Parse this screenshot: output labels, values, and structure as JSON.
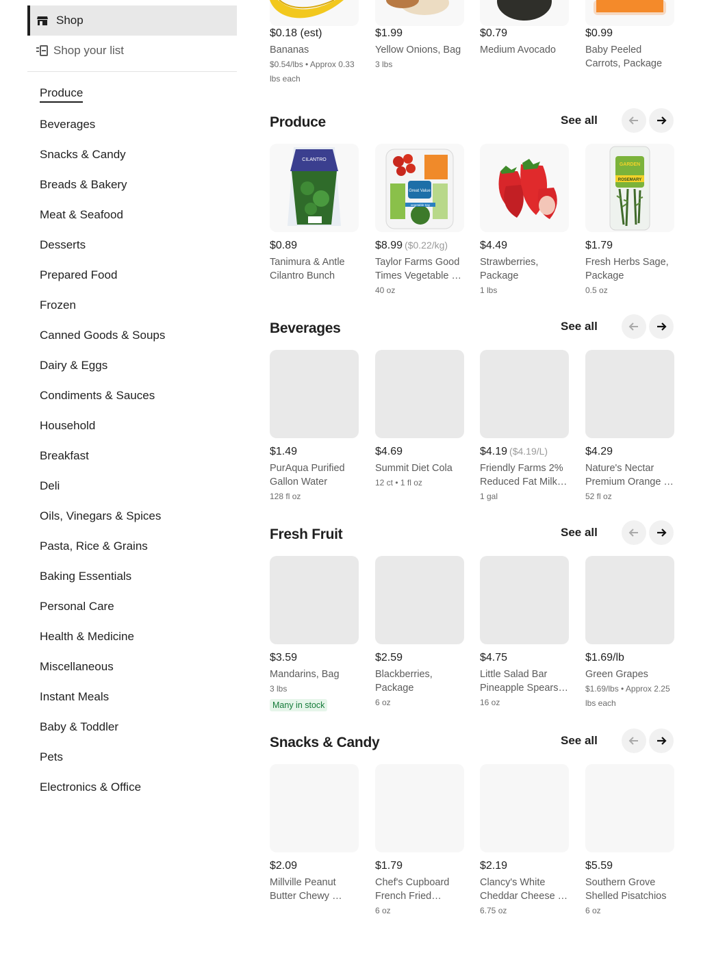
{
  "sidebar": {
    "shop_label": "Shop",
    "shop_icon": "store-icon",
    "list_label": "Shop your list",
    "list_icon": "list-icon",
    "categories": [
      "Produce",
      "Beverages",
      "Snacks & Candy",
      "Breads & Bakery",
      "Meat & Seafood",
      "Desserts",
      "Prepared Food",
      "Frozen",
      "Canned Goods & Soups",
      "Dairy & Eggs",
      "Condiments & Sauces",
      "Household",
      "Breakfast",
      "Deli",
      "Oils, Vinegars & Spices",
      "Pasta, Rice & Grains",
      "Baking Essentials",
      "Personal Care",
      "Health & Medicine",
      "Miscellaneous",
      "Instant Meals",
      "Baby & Toddler",
      "Pets",
      "Electronics & Office"
    ],
    "active_category": "Produce"
  },
  "top_row": {
    "items": [
      {
        "price": "$0.18 (est)",
        "name": "Bananas",
        "size": "$0.54/lbs • Approx 0.33 lbs each"
      },
      {
        "price": "$1.99",
        "name": "Yellow Onions, Bag",
        "size": "3 lbs"
      },
      {
        "price": "$0.79",
        "name": "Medium Avocado",
        "size": ""
      },
      {
        "price": "$0.99",
        "name": "Baby Peeled Carrots, Package",
        "size": ""
      }
    ]
  },
  "sections": [
    {
      "title": "Produce",
      "see_all": "See all",
      "items": [
        {
          "price": "$0.89",
          "unit": "",
          "name": "Tanimura & Antle Cilantro Bunch",
          "size": ""
        },
        {
          "price": "$8.99",
          "unit": "($0.22/kg)",
          "name": "Taylor Farms Good Times Vegetable …",
          "size": "40 oz"
        },
        {
          "price": "$4.49",
          "unit": "",
          "name": "Strawberries, Package",
          "size": "1 lbs"
        },
        {
          "price": "$1.79",
          "unit": "",
          "name": "Fresh Herbs Sage, Package",
          "size": "0.5 oz"
        }
      ],
      "image_labels": {
        "cilantro_tag": "CILANTRO",
        "herb_brand": "GARDEN",
        "herb_name": "ROSEMARY",
        "veg_brand": "Great Value",
        "veg_tray": "vegetable tray"
      }
    },
    {
      "title": "Beverages",
      "see_all": "See all",
      "items": [
        {
          "price": "$1.49",
          "unit": "",
          "name": "PurAqua Purified Gallon Water",
          "size": "128 fl oz"
        },
        {
          "price": "$4.69",
          "unit": "",
          "name": "Summit Diet Cola",
          "size": "12 ct • 1 fl oz"
        },
        {
          "price": "$4.19",
          "unit": "($4.19/L)",
          "name": "Friendly Farms 2% Reduced Fat Milk (…",
          "size": "1 gal"
        },
        {
          "price": "$4.29",
          "unit": "",
          "name": "Nature's Nectar Premium Orange …",
          "size": "52 fl oz"
        }
      ]
    },
    {
      "title": "Fresh Fruit",
      "see_all": "See all",
      "items": [
        {
          "price": "$3.59",
          "unit": "",
          "name": "Mandarins, Bag",
          "size": "3 lbs",
          "badge": "Many in stock"
        },
        {
          "price": "$2.59",
          "unit": "",
          "name": "Blackberries, Package",
          "size": "6 oz"
        },
        {
          "price": "$4.75",
          "unit": "",
          "name": "Little Salad Bar Pineapple Spears, …",
          "size": "16 oz"
        },
        {
          "price": "$1.69/lb",
          "unit": "",
          "name": "Green Grapes",
          "size": "$1.69/lbs • Approx 2.25 lbs each"
        }
      ]
    },
    {
      "title": "Snacks & Candy",
      "see_all": "See all",
      "items": [
        {
          "price": "$2.09",
          "unit": "",
          "name": "Millville Peanut Butter Chewy …",
          "size": ""
        },
        {
          "price": "$1.79",
          "unit": "",
          "name": "Chef's Cupboard French Fried Onions",
          "size": "6 oz"
        },
        {
          "price": "$2.19",
          "unit": "",
          "name": "Clancy's White Cheddar Cheese …",
          "size": "6.75 oz"
        },
        {
          "price": "$5.59",
          "unit": "",
          "name": "Southern Grove Shelled Pisatchios",
          "size": "6 oz"
        }
      ]
    }
  ],
  "icons": {
    "prev": "arrow-left-icon",
    "next": "arrow-right-icon"
  },
  "colors": {
    "in_stock_text": "#137a38",
    "in_stock_bg": "#e6f5ea",
    "placeholder": "#e9e9e9"
  }
}
